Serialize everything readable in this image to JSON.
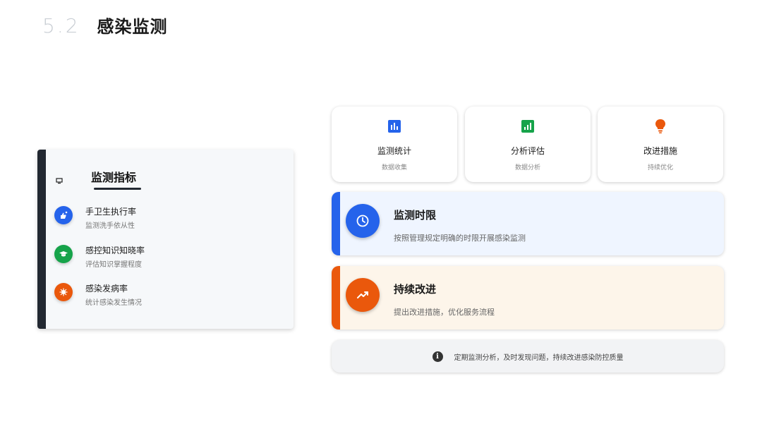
{
  "header": {
    "section_number": "5.2",
    "title": "感染监测"
  },
  "left_panel": {
    "title": "监测指标",
    "metrics": [
      {
        "name": "手卫生执行率",
        "desc": "监测洗手依从性",
        "icon": "hand-sparkle-icon",
        "color": "#2563eb"
      },
      {
        "name": "感控知识知晓率",
        "desc": "评估知识掌握程度",
        "icon": "graduation-cap-icon",
        "color": "#16a34a"
      },
      {
        "name": "感染发病率",
        "desc": "统计感染发生情况",
        "icon": "virus-icon",
        "color": "#ea580c"
      }
    ]
  },
  "features": [
    {
      "name": "监测统计",
      "sub": "数据收集",
      "icon": "bar-chart-icon",
      "color": "#2563eb"
    },
    {
      "name": "分析评估",
      "sub": "数据分析",
      "icon": "chart-square-icon",
      "color": "#16a34a"
    },
    {
      "name": "改进措施",
      "sub": "持续优化",
      "icon": "lightbulb-icon",
      "color": "#ea580c"
    }
  ],
  "cards": [
    {
      "title": "监测时限",
      "desc": "按照管理规定明确的时限开展感染监测",
      "icon": "clock-icon",
      "accent": "#2563eb",
      "bg": "#eff5ff"
    },
    {
      "title": "持续改进",
      "desc": "提出改进措施，优化服务流程",
      "icon": "trending-up-icon",
      "accent": "#ea580c",
      "bg": "#fdf5ea"
    }
  ],
  "note": {
    "text": "定期监测分析，及时发现问题，持续改进感染防控质量",
    "icon": "info-icon"
  }
}
